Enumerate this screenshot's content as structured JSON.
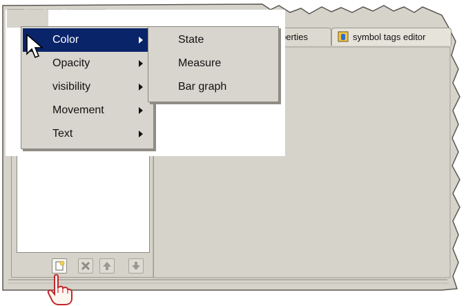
{
  "menu": {
    "items": [
      {
        "label": "Color",
        "has_submenu": true,
        "selected": true
      },
      {
        "label": "Opacity",
        "has_submenu": true
      },
      {
        "label": "visibility",
        "has_submenu": true
      },
      {
        "label": "Movement",
        "has_submenu": true
      },
      {
        "label": "Text",
        "has_submenu": true
      }
    ]
  },
  "submenu": {
    "items": [
      {
        "label": "State"
      },
      {
        "label": "Measure"
      },
      {
        "label": "Bar graph"
      }
    ]
  },
  "tabs": [
    {
      "label": "perties",
      "icon": "properties-icon"
    },
    {
      "label": "symbol tags editor",
      "icon": "tag-editor-icon"
    }
  ],
  "bottom_toolbar": {
    "buttons": [
      {
        "name": "new-button",
        "icon": "new-document-icon"
      },
      {
        "name": "delete-button",
        "icon": "delete-x-icon"
      },
      {
        "name": "move-up-button",
        "icon": "arrow-up-icon"
      },
      {
        "name": "move-down-button",
        "icon": "arrow-down-icon"
      }
    ]
  },
  "colors": {
    "menu_bg": "#d8d5ce",
    "menu_selected": "#0a246a",
    "panel_bg": "#d6d3cb"
  }
}
